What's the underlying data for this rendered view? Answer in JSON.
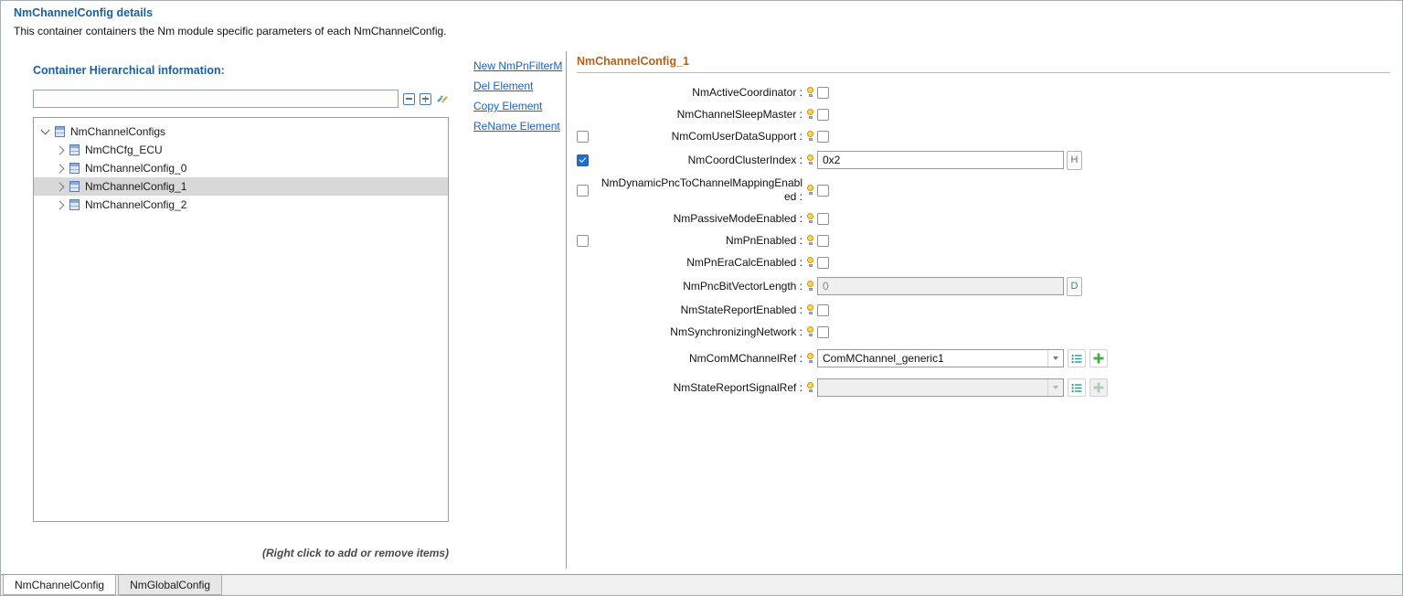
{
  "page": {
    "title": "NmChannelConfig details",
    "subtitle": "This container containers the Nm module specific parameters of each NmChannelConfig."
  },
  "left_panel": {
    "header": "Container Hierarchical information:",
    "filter_value": "",
    "tree": {
      "root": {
        "label": "NmChannelConfigs",
        "expanded": true
      },
      "children": [
        {
          "label": "NmChCfg_ECU",
          "selected": false
        },
        {
          "label": "NmChannelConfig_0",
          "selected": false
        },
        {
          "label": "NmChannelConfig_1",
          "selected": true
        },
        {
          "label": "NmChannelConfig_2",
          "selected": false
        }
      ]
    },
    "hint": "(Right click to add or remove items)"
  },
  "actions": {
    "links": [
      "New NmPnFilterM",
      "Del Element",
      "Copy Element",
      "ReName Element"
    ]
  },
  "detail": {
    "header": "NmChannelConfig_1",
    "rows": [
      {
        "label": "NmActiveCoordinator :",
        "control": "checkbox",
        "checked": false
      },
      {
        "label": "NmChannelSleepMaster :",
        "control": "checkbox",
        "checked": false
      },
      {
        "label": "NmComUserDataSupport :",
        "left_checkbox": true,
        "left_checked": false,
        "control": "checkbox",
        "checked": false
      },
      {
        "label": "NmCoordClusterIndex :",
        "left_checkbox": true,
        "left_checked": true,
        "control": "text",
        "value": "0x2",
        "button": "H",
        "disabled": false
      },
      {
        "label": "NmDynamicPncToChannelMappingEnabled :",
        "left_checkbox": true,
        "left_checked": false,
        "control": "checkbox",
        "checked": false
      },
      {
        "label": "NmPassiveModeEnabled :",
        "control": "checkbox",
        "checked": false
      },
      {
        "label": "NmPnEnabled :",
        "left_checkbox": true,
        "left_checked": false,
        "control": "checkbox",
        "checked": false
      },
      {
        "label": "NmPnEraCalcEnabled :",
        "control": "checkbox",
        "checked": false
      },
      {
        "label": "NmPncBitVectorLength :",
        "control": "text",
        "value": "0",
        "button": "D",
        "disabled": true
      },
      {
        "label": "NmStateReportEnabled :",
        "control": "checkbox",
        "checked": false
      },
      {
        "label": "NmSynchronizingNetwork :",
        "control": "checkbox",
        "checked": false
      },
      {
        "label": "NmComMChannelRef :",
        "control": "select",
        "value": "ComMChannel_generic1",
        "has_list_button": true,
        "has_add_button": true,
        "disabled": false
      },
      {
        "label": "NmStateReportSignalRef :",
        "control": "select",
        "value": "",
        "has_list_button": true,
        "has_add_button": true,
        "disabled": true
      }
    ]
  },
  "tabs": [
    {
      "label": "NmChannelConfig",
      "active": true
    },
    {
      "label": "NmGlobalConfig",
      "active": false
    }
  ],
  "colors": {
    "header_blue": "#1a5f9e",
    "detail_header": "#b4621d",
    "link": "#1a62c4",
    "checked_checkbox": "#1e6fd0",
    "tree_selection_bg": "#d8d8d8",
    "add_button_green": "#3fae49",
    "list_icon_teal": "#2a9a8a",
    "bulb_yellow": "#ffd54a"
  },
  "icons": {
    "collapse_all": "minus-square",
    "expand_all": "plus-square",
    "refresh": "double-arrows",
    "parameter": "bulb",
    "list": "list-lines",
    "add": "plus",
    "chevron_down": "chevron-down",
    "chevron_right": "chevron-right",
    "container": "blue-box"
  }
}
